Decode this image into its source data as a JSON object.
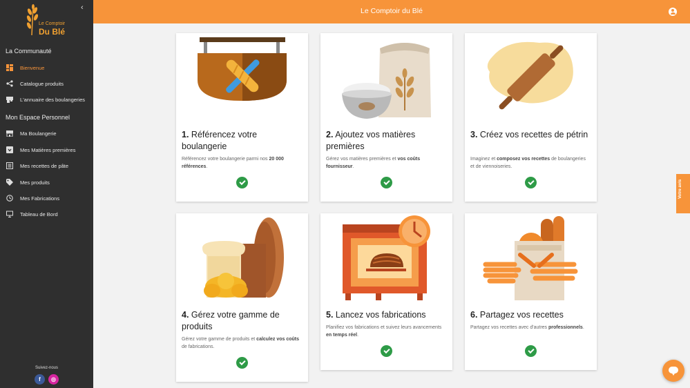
{
  "app": {
    "title": "Le Comptoir du Blé",
    "logo_line1": "Le Comptoir",
    "logo_line2": "Du Blé",
    "collapse_glyph": "‹"
  },
  "sidebar": {
    "section1": "La Communauté",
    "section2": "Mon Espace Personnel",
    "items1": [
      {
        "label": "Bienvenue",
        "icon": "dashboard-icon"
      },
      {
        "label": "Catalogue produits",
        "icon": "share-icon"
      },
      {
        "label": "L'annuaire des boulangeries",
        "icon": "storefront-icon"
      }
    ],
    "items2": [
      {
        "label": "Ma Boulangerie",
        "icon": "store-icon"
      },
      {
        "label": "Mes Matières premières",
        "icon": "inbox-icon"
      },
      {
        "label": "Mes recettes de pâte",
        "icon": "list-icon"
      },
      {
        "label": "Mes produits",
        "icon": "tag-icon"
      },
      {
        "label": "Mes Fabrications",
        "icon": "clock-icon"
      },
      {
        "label": "Tableau de Bord",
        "icon": "monitor-icon"
      }
    ],
    "follow_label": "Suivez-nous",
    "facebook_glyph": "f",
    "instagram_glyph": "◎"
  },
  "colors": {
    "accent": "#f7943a",
    "sidebar_bg": "#2f2f2f",
    "success": "#2e9b47"
  },
  "cards": [
    {
      "num": "1.",
      "title": "Référencez votre boulangerie",
      "desc": [
        "Référencez votre boulangerie parmi nos ",
        "20 000 références",
        "."
      ],
      "icon": "shop-sign-icon",
      "done": true
    },
    {
      "num": "2.",
      "title": "Ajoutez vos matières premières",
      "desc": [
        "Gérez vos matières premières et ",
        "vos coûts fournisseur",
        "."
      ],
      "icon": "flour-sack-icon",
      "done": true
    },
    {
      "num": "3.",
      "title": "Créez vos recettes de pétrin",
      "desc": [
        "Imaginez et ",
        "composez vos recettes",
        " de boulangeries et de viennoiseries."
      ],
      "icon": "rolling-pin-icon",
      "done": true
    },
    {
      "num": "4.",
      "title": "Gérez votre gamme de produits",
      "desc": [
        "Gérez votre gamme de produits et ",
        "calculez vos coûts",
        " de fabrications."
      ],
      "icon": "breads-icon",
      "done": true
    },
    {
      "num": "5.",
      "title": "Lancez vos fabrications",
      "desc": [
        "Planifiez vos fabrications et suivez leurs avancements ",
        "en temps réel",
        "."
      ],
      "icon": "oven-icon",
      "done": true
    },
    {
      "num": "6.",
      "title": "Partagez vos recettes",
      "desc": [
        "Partagez vos recettes avec d'autres ",
        "professionnels",
        "."
      ],
      "icon": "bread-bag-icon",
      "done": true
    }
  ],
  "feedback_label": "Votre avis"
}
